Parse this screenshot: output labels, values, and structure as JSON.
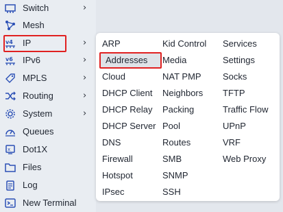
{
  "sidebar": {
    "items": [
      {
        "label": "Switch",
        "icon": "switch-icon",
        "has_submenu": true
      },
      {
        "label": "Mesh",
        "icon": "mesh-icon",
        "has_submenu": false
      },
      {
        "label": "IP",
        "icon": "ip-icon",
        "has_submenu": true,
        "active": true
      },
      {
        "label": "IPv6",
        "icon": "ipv6-icon",
        "has_submenu": true
      },
      {
        "label": "MPLS",
        "icon": "mpls-icon",
        "has_submenu": true
      },
      {
        "label": "Routing",
        "icon": "routing-icon",
        "has_submenu": true
      },
      {
        "label": "System",
        "icon": "system-icon",
        "has_submenu": true
      },
      {
        "label": "Queues",
        "icon": "queues-icon",
        "has_submenu": false
      },
      {
        "label": "Dot1X",
        "icon": "dot1x-icon",
        "has_submenu": false
      },
      {
        "label": "Files",
        "icon": "folder-icon",
        "has_submenu": false
      },
      {
        "label": "Log",
        "icon": "log-icon",
        "has_submenu": false
      },
      {
        "label": "New Terminal",
        "icon": "terminal-icon",
        "has_submenu": false
      }
    ],
    "chevron": "›"
  },
  "submenu": {
    "columns": [
      [
        "ARP",
        "Addresses",
        "Cloud",
        "DHCP Client",
        "DHCP Relay",
        "DHCP Server",
        "DNS",
        "Firewall",
        "Hotspot",
        "IPsec"
      ],
      [
        "Kid Control",
        "Media",
        "NAT PMP",
        "Neighbors",
        "Packing",
        "Pool",
        "Routes",
        "SMB",
        "SNMP",
        "SSH"
      ],
      [
        "Services",
        "Settings",
        "Socks",
        "TFTP",
        "Traffic Flow",
        "UPnP",
        "VRF",
        "Web Proxy"
      ]
    ],
    "highlighted": "Addresses"
  },
  "colors": {
    "accent_red": "#e02020",
    "icon_blue": "#2a4fb5",
    "background": "#e3e7ed",
    "panel": "#ffffff"
  }
}
